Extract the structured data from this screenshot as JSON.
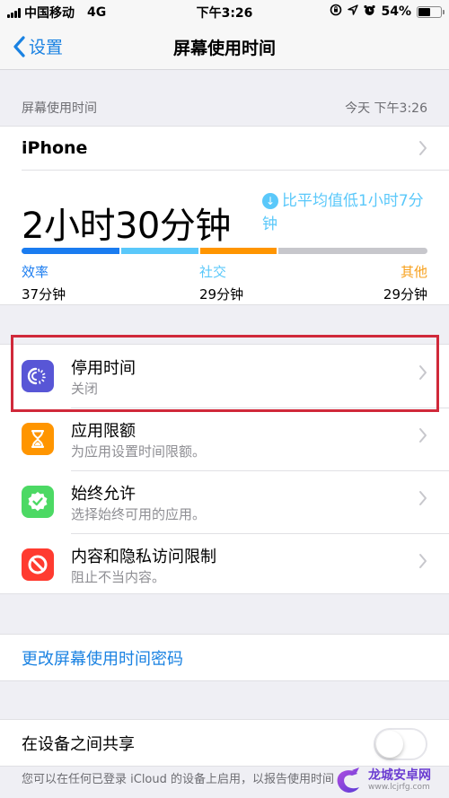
{
  "status_bar": {
    "carrier": "中国移动",
    "network": "4G",
    "time": "下午3:26",
    "battery_percent_text": "54%",
    "battery_level": 0.54,
    "icons": [
      "signal-icon",
      "orientation-lock-icon",
      "location-icon",
      "alarm-icon",
      "battery-icon"
    ]
  },
  "nav": {
    "back_label": "设置",
    "title": "屏幕使用时间"
  },
  "section_header": {
    "title": "屏幕使用时间",
    "timestamp": "今天 下午3:26"
  },
  "summary": {
    "device": "iPhone",
    "total": "2小时30分钟",
    "compare": "比平均值低1小时7分钟",
    "categories": [
      {
        "label": "效率",
        "value": "37分钟",
        "minutes": 37,
        "color": "#1a7cf0"
      },
      {
        "label": "社交",
        "value": "29分钟",
        "minutes": 29,
        "color": "#5ac8fa"
      },
      {
        "label": "其他",
        "value": "29分钟",
        "minutes": 29,
        "color": "#f7a01b"
      }
    ],
    "usage_segments": [
      {
        "name": "efficiency",
        "minutes": 37,
        "color": "#1a7cf0"
      },
      {
        "name": "social",
        "minutes": 29,
        "color": "#5ac8fa"
      },
      {
        "name": "other",
        "minutes": 29,
        "color": "#ff9500"
      },
      {
        "name": "remaining",
        "minutes": 55,
        "color": "#c7c7cc"
      }
    ]
  },
  "settings": [
    {
      "title": "停用时间",
      "subtitle": "关闭",
      "icon": "downtime-icon",
      "color": "#5856d6",
      "highlighted": true
    },
    {
      "title": "应用限额",
      "subtitle": "为应用设置时间限额。",
      "icon": "hourglass-icon",
      "color": "#ff9500"
    },
    {
      "title": "始终允许",
      "subtitle": "选择始终可用的应用。",
      "icon": "checkmark-badge-icon",
      "color": "#4cd964"
    },
    {
      "title": "内容和隐私访问限制",
      "subtitle": "阻止不当内容。",
      "icon": "no-entry-icon",
      "color": "#ff3b30"
    }
  ],
  "passcode_link": "更改屏幕使用时间密码",
  "share": {
    "label": "在设备之间共享",
    "enabled": false,
    "footnote": "您可以在任何已登录 iCloud 的设备上启用，以报告使用时间"
  },
  "watermark": {
    "title": "龙城安卓网",
    "url": "www.lcjrfg.com"
  }
}
